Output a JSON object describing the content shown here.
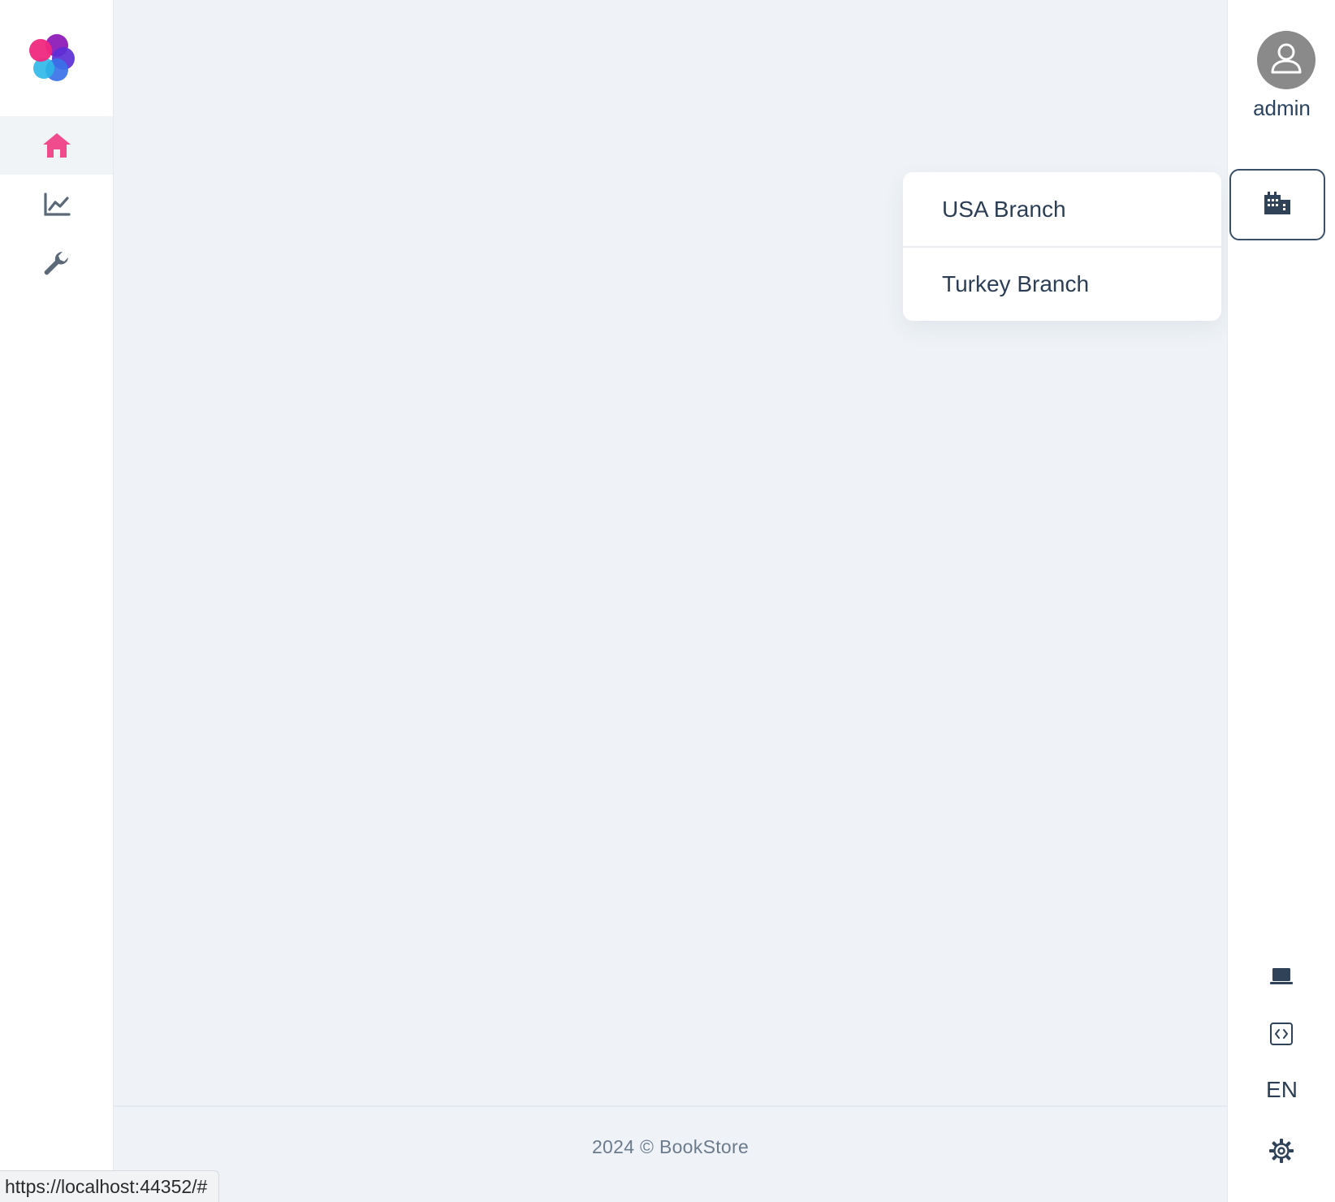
{
  "sidebar": {
    "logo": "abp-logo",
    "items": [
      {
        "icon": "home-icon",
        "active": true
      },
      {
        "icon": "chart-line-icon",
        "active": false
      },
      {
        "icon": "wrench-icon",
        "active": false
      }
    ],
    "active_color": "#f03e87",
    "icon_color": "#5b6878"
  },
  "user": {
    "name": "admin",
    "avatar_icon": "user-avatar-icon"
  },
  "tenant_switcher": {
    "icon": "building-icon"
  },
  "branch_menu": {
    "items": [
      {
        "label": "USA Branch"
      },
      {
        "label": "Turkey Branch"
      }
    ]
  },
  "toolbar": {
    "tools": [
      {
        "icon": "laptop-icon"
      },
      {
        "icon": "code-square-icon"
      }
    ],
    "language": "EN",
    "settings_icon": "gear-icon"
  },
  "footer": {
    "text": "2024 © BookStore"
  },
  "status_bar": {
    "url": "https://localhost:44352/#"
  }
}
